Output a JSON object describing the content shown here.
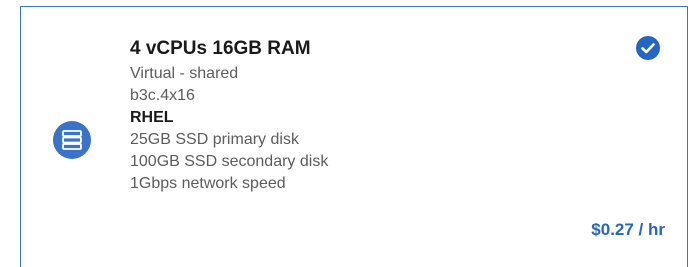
{
  "card": {
    "title": "4 vCPUs 16GB RAM",
    "type": "Virtual - shared",
    "profile": "b3c.4x16",
    "os": "RHEL",
    "primary_disk": "25GB SSD primary disk",
    "secondary_disk": "100GB SSD secondary disk",
    "network": "1Gbps network speed",
    "price": "$0.27 / hr",
    "selected": true,
    "icons": {
      "server": "server-icon",
      "selected": "checkmark-circle-icon"
    },
    "colors": {
      "accent": "#2566c4",
      "icon_bg": "#3a73c7",
      "border": "#3b73c8"
    }
  }
}
